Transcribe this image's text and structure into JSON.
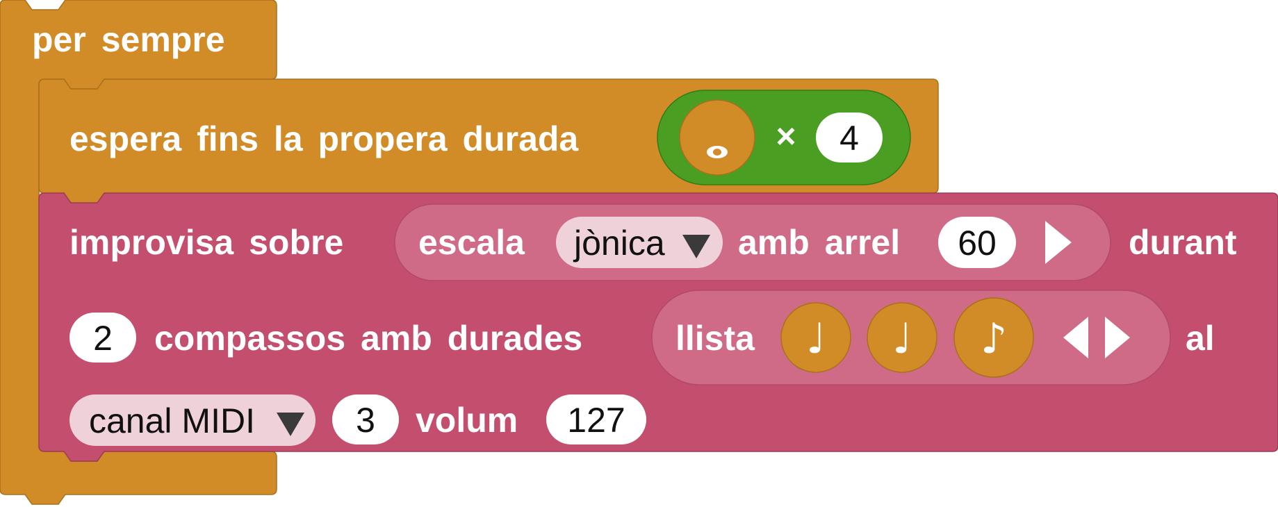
{
  "colors": {
    "control": "#d18b27",
    "control_border": "#a9701c",
    "music": "#c44e6e",
    "music_border": "#9d3b56",
    "music_inner": "#cf6b86",
    "duration_green": "#4a9e22",
    "dropdown_bg": "#efd1da",
    "white": "#ffffff"
  },
  "forever_block": {
    "label": "per sempre"
  },
  "wait_block": {
    "label": "espera fins la propera durada",
    "duration_icon": "whole-note-icon",
    "times_symbol": "×",
    "multiplier": "4"
  },
  "improvise_block": {
    "label": "improvisa sobre",
    "scale": {
      "label": "escala",
      "mode_value": "jònica",
      "root_label": "amb arrel",
      "root_value": "60"
    },
    "during_label": "durant",
    "bars_value": "2",
    "bars_label": "compassos amb durades",
    "durations_list": {
      "label": "llista",
      "items": [
        {
          "icon": "quarter-note-icon",
          "glyph": "♩"
        },
        {
          "icon": "quarter-note-icon",
          "glyph": "♩"
        },
        {
          "icon": "eighth-note-icon",
          "glyph": "♪"
        }
      ]
    },
    "at_label": "al",
    "channel_dropdown": "canal MIDI",
    "channel_value": "3",
    "volume_label": "volum",
    "volume_value": "127"
  }
}
